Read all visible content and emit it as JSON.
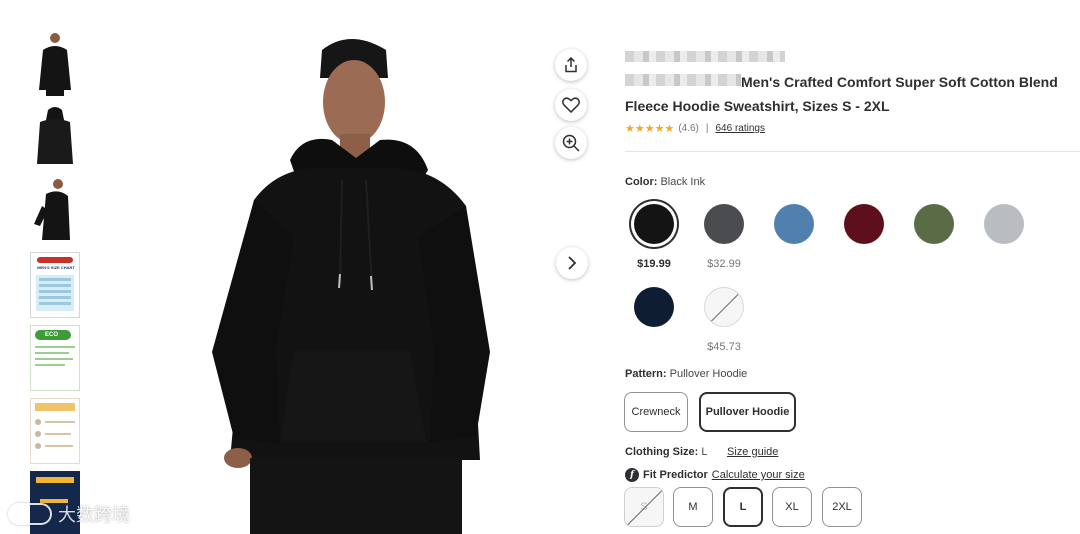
{
  "product": {
    "title_rest": "Men's Crafted Comfort Super Soft Cotton Blend Fleece Hoodie Sweatshirt, Sizes S - 2XL",
    "rating_stars": "★★★★★",
    "rating_value": "(4.6)",
    "rating_separator": "|",
    "ratings_count": "646 ratings"
  },
  "gallery": {
    "thumbnails": [
      "hoodie-front",
      "hoodie-back",
      "hoodie-side",
      "size-chart",
      "eco-packaging",
      "fit-info",
      "guarantee"
    ],
    "size_chart_title": "MEN'S SIZE CHART",
    "eco_tag": "ECO",
    "watermark_text": "大数跨境"
  },
  "actions": {
    "share_icon": "share-icon",
    "favorite_icon": "heart-icon",
    "zoom_icon": "zoom-in-icon",
    "next_icon": "chevron-right-icon"
  },
  "color": {
    "label": "Color:",
    "selected": "Black Ink",
    "options": [
      {
        "name": "Black Ink",
        "hex": "#141414",
        "price": "$19.99",
        "selected": true
      },
      {
        "name": "Charcoal",
        "hex": "#4b4c50",
        "price": "$32.99"
      },
      {
        "name": "Blue",
        "hex": "#4f80ae",
        "price": ""
      },
      {
        "name": "Maroon",
        "hex": "#5e0f1e",
        "price": ""
      },
      {
        "name": "Olive",
        "hex": "#5b6b45",
        "price": ""
      },
      {
        "name": "Light Gray",
        "hex": "#b9bcc0",
        "price": ""
      },
      {
        "name": "Navy",
        "hex": "#0f1d33",
        "price": ""
      },
      {
        "name": "White",
        "hex": "#f6f6f6",
        "price": "$45.73",
        "unavailable": true
      }
    ]
  },
  "pattern": {
    "label": "Pattern:",
    "selected": "Pullover Hoodie",
    "options": [
      "Crewneck",
      "Pullover Hoodie"
    ]
  },
  "size": {
    "label": "Clothing Size:",
    "selected": "L",
    "guide_link": "Size guide",
    "fit_icon": "f",
    "fit_label": "Fit Predictor",
    "fit_link": "Calculate your size",
    "options": [
      "S",
      "M",
      "L",
      "XL",
      "2XL"
    ]
  }
}
